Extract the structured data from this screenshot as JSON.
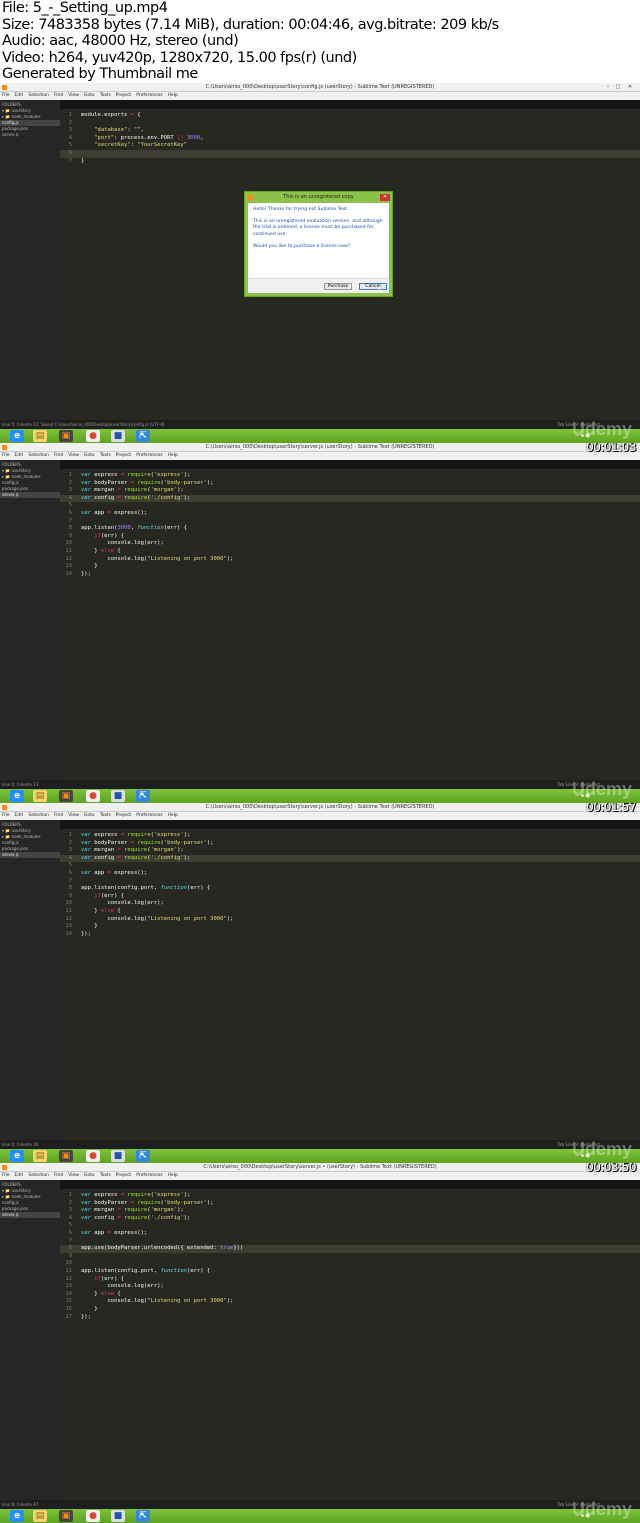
{
  "header": {
    "file": "File: 5_-_Setting_up.mp4",
    "size": "Size: 7483358 bytes (7.14 MiB), duration: 00:04:46, avg.bitrate: 209 kb/s",
    "audio": "Audio: aac, 48000 Hz, stereo (und)",
    "video": "Video: h264, yuv420p, 1280x720, 15.00 fps(r) (und)",
    "generated": "Generated by Thumbnail me"
  },
  "menu": [
    "File",
    "Edit",
    "Selection",
    "Find",
    "View",
    "Goto",
    "Tools",
    "Project",
    "Preferences",
    "Help"
  ],
  "watermark": "Udemy",
  "frames": [
    {
      "title": "C:\\Users\\airso_000\\Desktop\\userStory\\config.js (userStory) - Sublime Text (UNREGISTERED)",
      "tabs": [
        "server.js",
        "config.js",
        "package.json"
      ],
      "active_tab": 1,
      "sidebar": [
        "FOLDERS",
        "▾ 📁 userStory",
        "  ▸ 📁 node_modules",
        "     config.js",
        "     package.json",
        "     server.js"
      ],
      "sidebar_sel": 3,
      "lines": [
        "module.exports = {",
        "",
        "    \"database\": \"\",",
        "    \"port\": process.env.PORT || 3000,",
        "    \"secretKey\": \"YourSecretKey\"",
        "",
        "}"
      ],
      "highlight": 5,
      "status": "Line 5, Column 12; Saved C:\\Users\\airso_000\\Desktop\\userStory\\config.js (UTF-8)",
      "status_right": "Tab Size: 4    JavaScript",
      "timestamp": "",
      "dialog": {
        "title": "This is an unregistered copy",
        "p1": "Hello! Thanks for trying out Sublime Text.",
        "p2": "This is an unregistered evaluation version, and although the trial is untimed, a license must be purchased for continued use.",
        "p3": "Would you like to purchase a license now?",
        "purchase": "Purchase",
        "cancel": "Cancel"
      }
    },
    {
      "title": "C:\\Users\\airso_000\\Desktop\\userStory\\server.js (userStory) - Sublime Text (UNREGISTERED)",
      "tabs": [
        "server.js",
        "config.js",
        "package.json"
      ],
      "active_tab": 0,
      "sidebar": [
        "FOLDERS",
        "▾ 📁 userStory",
        "  ▸ 📁 node_modules",
        "     config.js",
        "     package.json",
        "     server.js"
      ],
      "sidebar_sel": 5,
      "lines": [
        "var express = require('express');",
        "var bodyParser = require('body-parser');",
        "var morgan = require('morgan');",
        "var config = require('./config');",
        "",
        "var app = express();",
        "",
        "app.listen(3000, function(err) {",
        "    if(err) {",
        "        console.log(err);",
        "    } else {",
        "        console.log(\"Listening on port 3000\");",
        "    }",
        "});"
      ],
      "highlight": 3,
      "status": "Line 4, Column 11",
      "status_right": "Tab Size: 4    JavaScript",
      "timestamp": "00:01:03",
      "dialog": null
    },
    {
      "title": "C:\\Users\\airso_000\\Desktop\\userStory\\server.js (userStory) - Sublime Text (UNREGISTERED)",
      "tabs": [
        "server.js",
        "config.js",
        "package.json"
      ],
      "active_tab": 0,
      "sidebar": [
        "FOLDERS",
        "▾ 📁 userStory",
        "  ▸ 📁 node_modules",
        "     config.js",
        "     package.json",
        "     server.js"
      ],
      "sidebar_sel": 5,
      "lines": [
        "var express = require('express');",
        "var bodyParser = require('body-parser');",
        "var morgan = require('morgan');",
        "var config = require('./config');",
        "",
        "var app = express();",
        "",
        "app.listen(config.port, function(err) {",
        "    if(err) {",
        "        console.log(err);",
        "    } else {",
        "        console.log(\"Listening on port 3000\");",
        "    }",
        "});"
      ],
      "highlight": 3,
      "status": "Line 4, Column 34",
      "status_right": "Tab Size: 4    JavaScript",
      "timestamp": "00:01:57",
      "dialog": null
    },
    {
      "title": "C:\\Users\\airso_000\\Desktop\\userStory\\server.js • (userStory) - Sublime Text (UNREGISTERED)",
      "tabs": [
        "server.js",
        "config.js",
        "package.json"
      ],
      "active_tab": 0,
      "sidebar": [
        "FOLDERS",
        "▾ 📁 userStory",
        "  ▸ 📁 node_modules",
        "     config.js",
        "     package.json",
        "     server.js"
      ],
      "sidebar_sel": 5,
      "lines": [
        "var express = require('express');",
        "var bodyParser = require('body-parser');",
        "var morgan = require('morgan');",
        "var config = require('./config');",
        "",
        "var app = express();",
        "",
        "app.use(bodyParser.urlencoded({ extended: true}))",
        "",
        "",
        "app.listen(config.port, function(err) {",
        "    if(err) {",
        "        console.log(err);",
        "    } else {",
        "        console.log(\"Listening on port 3000\");",
        "    }",
        "});"
      ],
      "highlight": 7,
      "status": "Line 8, Column 47",
      "status_right": "Tab Size: 4    JavaScript",
      "timestamp": "00:03:50",
      "dialog": null
    }
  ]
}
